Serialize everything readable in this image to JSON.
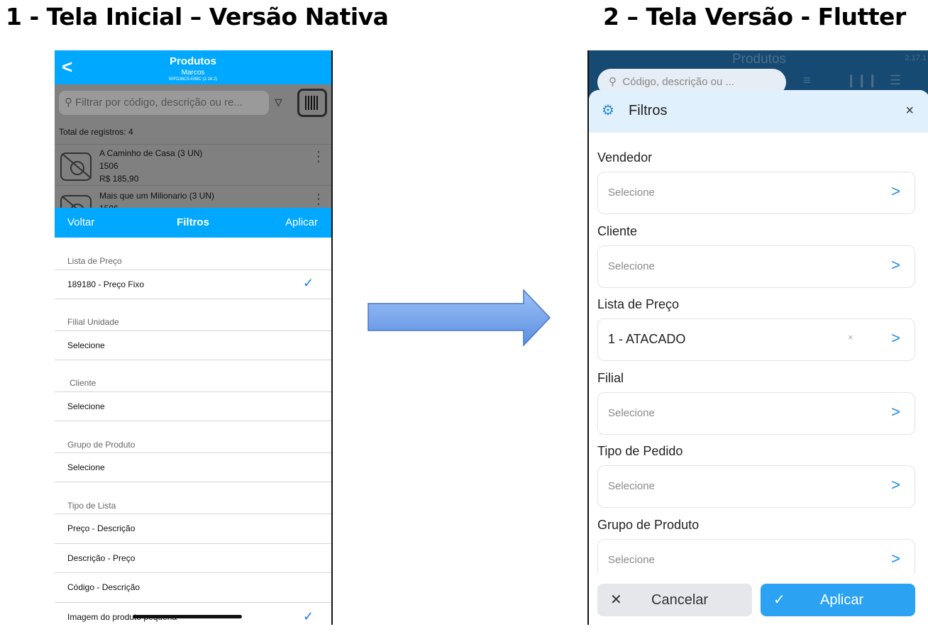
{
  "headings": {
    "left": "1 - Tela Inicial – Versão Nativa",
    "right": "2 – Tela Versão - Flutter"
  },
  "native": {
    "header": {
      "back": "<",
      "title": "Produtos",
      "user": "Marcos",
      "device": "50FD36C5-E89C (2.16.2)"
    },
    "search_placeholder": "Filtrar por código, descrição ou re...",
    "total": "Total de registros: 4",
    "products": [
      {
        "name": "A Caminho de Casa (3 UN)",
        "code": "1506",
        "price": "R$ 185,90"
      },
      {
        "name": "Mais que um Milionario (3 UN)",
        "code": "1506",
        "price": ""
      }
    ],
    "filterbar": {
      "back": "Voltar",
      "title": "Filtros",
      "apply": "Aplicar"
    },
    "sections": {
      "price_list": "Lista de Preço",
      "price_list_value": "189180 - Preço Fixo",
      "branch": "Filial Unidade",
      "branch_value": "Selecione",
      "client": "Cliente",
      "client_value": "Selecione",
      "group": "Grupo de Produto",
      "group_value": "Selecione",
      "list_type": "Tipo de Lista",
      "list_options": [
        "Preço - Descrição",
        "Descrição - Preço",
        "Código - Descrição",
        "Imagem do produto pequena"
      ]
    },
    "check": "✓"
  },
  "flutter": {
    "header": {
      "title": "Produtos",
      "version": "2.17.1",
      "search_placeholder": "Código, descrição ou ..."
    },
    "sheet_title": "Filtros",
    "close": "×",
    "fields": [
      {
        "label": "Vendedor",
        "value": "Selecione"
      },
      {
        "label": "Cliente",
        "value": "Selecione"
      },
      {
        "label": "Lista de Preço",
        "value": "1 - ATACADO",
        "clear": "×"
      },
      {
        "label": "Filial",
        "value": "Selecione"
      },
      {
        "label": "Tipo de Pedido",
        "value": "Selecione"
      },
      {
        "label": "Grupo de Produto",
        "value": "Selecione"
      }
    ],
    "chevron": ">",
    "cancel": "Cancelar",
    "apply": "Aplicar"
  },
  "colors": {
    "native_accent": "#00a8ff",
    "flutter_primary": "#164a72",
    "flutter_button": "#2ba3f2",
    "arrow": "#6d9ee8"
  }
}
